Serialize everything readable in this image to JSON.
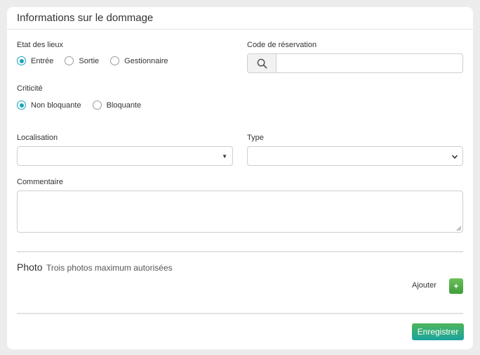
{
  "card": {
    "title": "Informations sur le dommage"
  },
  "etat": {
    "label": "Etat des lieux",
    "options": [
      {
        "label": "Entrée",
        "checked": true
      },
      {
        "label": "Sortie",
        "checked": false
      },
      {
        "label": "Gestionnaire",
        "checked": false
      }
    ]
  },
  "reservation": {
    "label": "Code de réservation",
    "value": "",
    "icon": "search-icon"
  },
  "criticite": {
    "label": "Criticité",
    "options": [
      {
        "label": "Non bloquante",
        "checked": true
      },
      {
        "label": "Bloquante",
        "checked": false
      }
    ]
  },
  "localisation": {
    "label": "Localisation",
    "value": ""
  },
  "type": {
    "label": "Type",
    "value": ""
  },
  "commentaire": {
    "label": "Commentaire",
    "value": ""
  },
  "photo": {
    "title": "Photo",
    "hint": "Trois photos maximum autorisées",
    "add_label": "Ajouter",
    "add_button": "+"
  },
  "actions": {
    "save_label": "Enregistrer"
  },
  "colors": {
    "accent": "#1aa3b8",
    "button_green": "#4db55a",
    "button_teal": "#1aa3a0"
  }
}
